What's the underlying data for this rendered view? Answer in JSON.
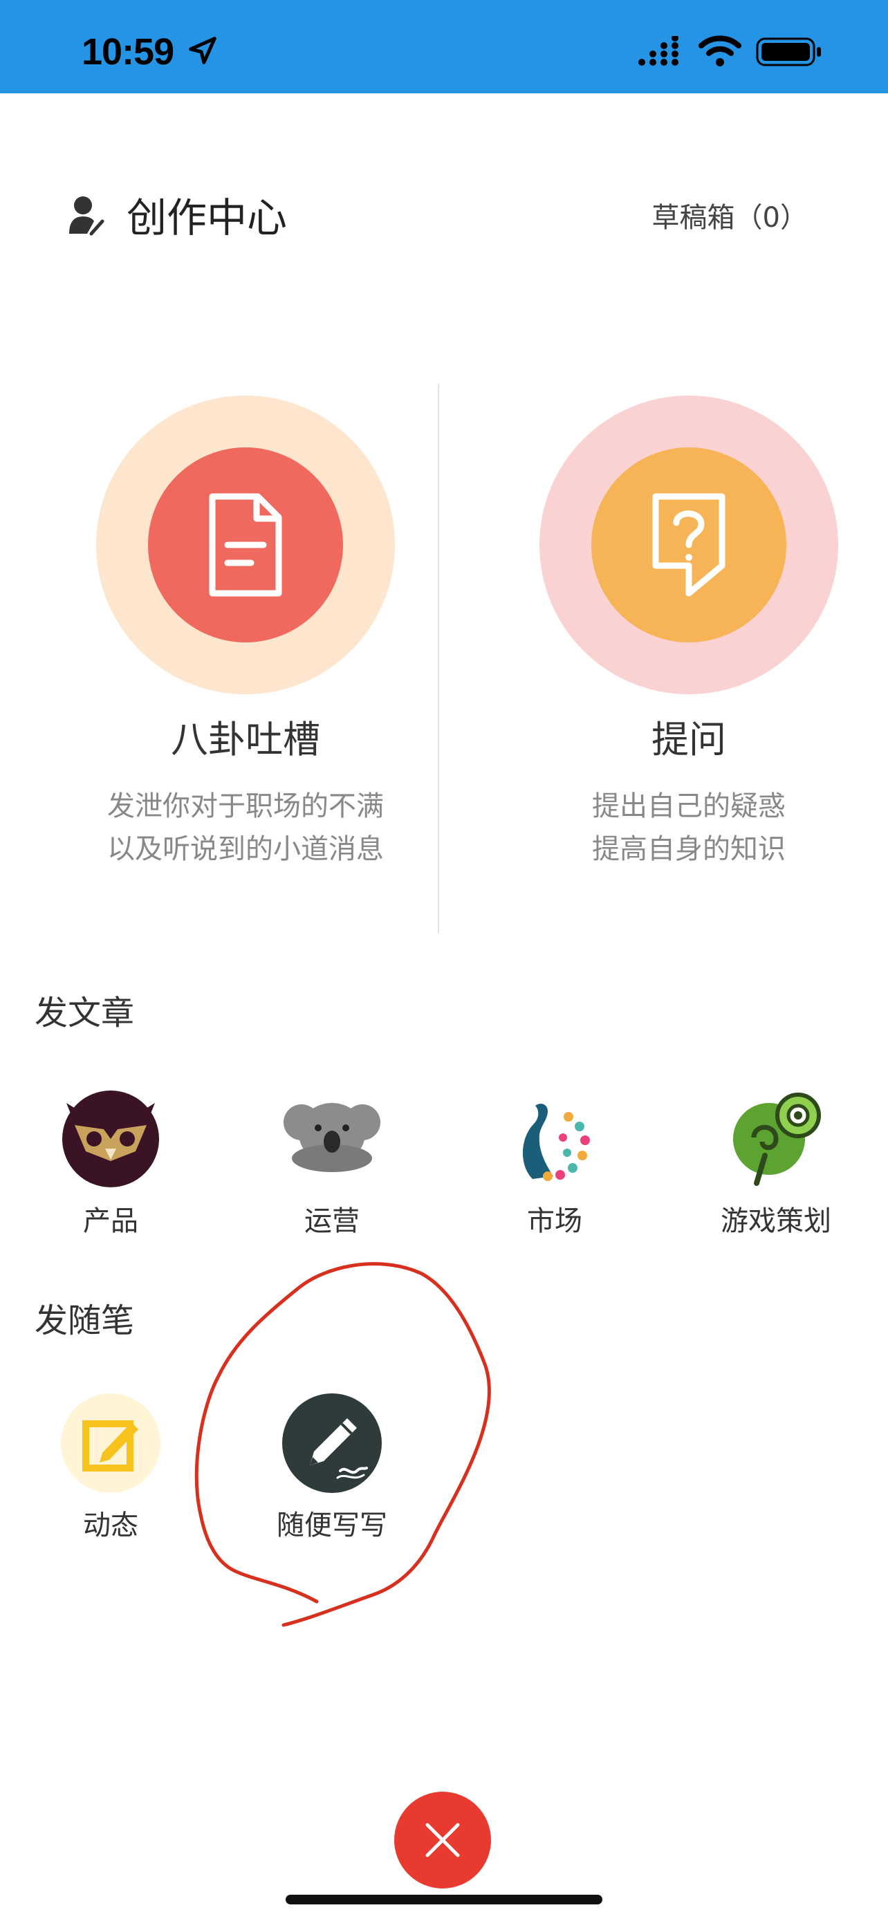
{
  "status_bar": {
    "time": "10:59",
    "background": "#2694E4"
  },
  "header": {
    "title": "创作中心",
    "drafts_label": "草稿箱（0）"
  },
  "features": [
    {
      "title": "八卦吐槽",
      "description_line1": "发泄你对于职场的不满",
      "description_line2": "以及听说到的小道消息",
      "icon": "document-icon",
      "outer_color": "#FDE6CD",
      "inner_color": "#F0695F"
    },
    {
      "title": "提问",
      "description_line1": "提出自己的疑惑",
      "description_line2": "提高自身的知识",
      "icon": "question-note-icon",
      "outer_color": "#FBD2D2",
      "inner_color": "#F7B457"
    }
  ],
  "article_section": {
    "heading": "发文章",
    "categories": [
      {
        "label": "产品",
        "icon": "owl-icon"
      },
      {
        "label": "运营",
        "icon": "koala-icon"
      },
      {
        "label": "市场",
        "icon": "peacock-icon"
      },
      {
        "label": "游戏策划",
        "icon": "chameleon-icon"
      }
    ]
  },
  "essay_section": {
    "heading": "发随笔",
    "items": [
      {
        "label": "动态",
        "icon": "edit-note-icon"
      },
      {
        "label": "随便写写",
        "icon": "pencil-icon"
      }
    ]
  },
  "close_button": {
    "icon": "close-icon",
    "color": "#E83A2E"
  }
}
